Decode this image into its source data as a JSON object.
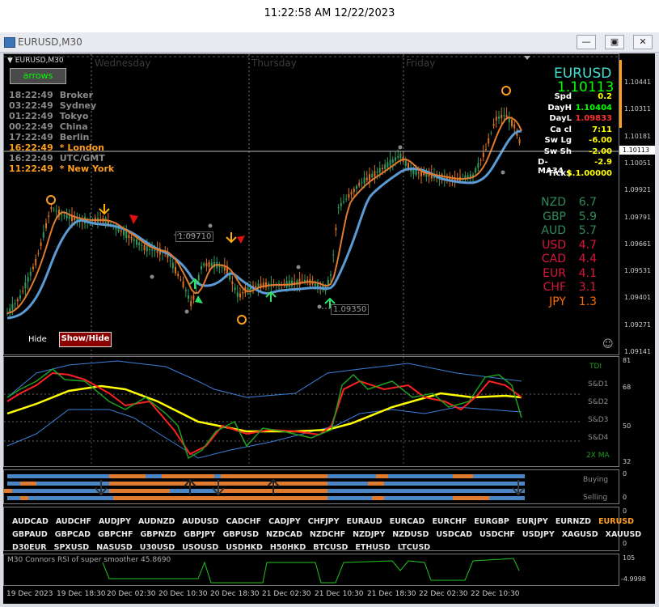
{
  "clock": "11:22:58 AM 12/22/2023",
  "window": {
    "title": "EURUSD,M30"
  },
  "chart": {
    "label": "EURUSD,M30",
    "arrows_button": "arrows",
    "days": [
      "Wednesday",
      "Thursday",
      "Friday"
    ],
    "sessions": [
      {
        "time": "18:22:49",
        "name": "Broker",
        "color": "#8a8a8a"
      },
      {
        "time": "03:22:49",
        "name": "Sydney",
        "color": "#8a8a8a"
      },
      {
        "time": "01:22:49",
        "name": "Tokyo",
        "color": "#8a8a8a"
      },
      {
        "time": "00:22:49",
        "name": "China",
        "color": "#8a8a8a"
      },
      {
        "time": "17:22:49",
        "name": "Berlin",
        "color": "#8a8a8a"
      },
      {
        "time": "16:22:49",
        "name": "* London",
        "color": "#ff9e1b"
      },
      {
        "time": "16:22:49",
        "name": "UTC/GMT",
        "color": "#8a8a8a"
      },
      {
        "time": "11:22:49",
        "name": "* New York",
        "color": "#ff9e1b"
      }
    ],
    "hide_label": "Hide",
    "show_hide_button": "Show/Hide",
    "price_ticks": [
      "1.10441",
      "1.10311",
      "1.10181",
      "1.10051",
      "1.09921",
      "1.09791",
      "1.09661",
      "1.09531",
      "1.09401",
      "1.09271",
      "1.09141"
    ],
    "current_price": "1.10113",
    "annotations": {
      "high_label": "1.09710",
      "low_label": "1.09350"
    }
  },
  "info": {
    "symbol": "EURUSD",
    "price": "1.10113",
    "rows": [
      {
        "label": "Spd",
        "value": "0.2",
        "color": "#ffff00"
      },
      {
        "label": "DayH",
        "value": "1.10404",
        "color": "#00ff00"
      },
      {
        "label": "DayL",
        "value": "1.09833",
        "color": "#ff3030"
      },
      {
        "label": "Ca cl",
        "value": "7:11",
        "color": "#ffff00"
      },
      {
        "label": "Sw Lg",
        "value": "-6.00",
        "color": "#ffff00"
      },
      {
        "label": "Sw Sh",
        "value": "-2.00",
        "color": "#ffff00"
      },
      {
        "label": "D-MA34",
        "value": "-2.9",
        "color": "#ffff00"
      },
      {
        "label": "Tick$",
        "value": "$.1.00000",
        "color": "#ffff00"
      }
    ]
  },
  "strength": [
    {
      "cur": "NZD",
      "val": "6.7",
      "color": "#2e8b57"
    },
    {
      "cur": "GBP",
      "val": "5.9",
      "color": "#2e8b57"
    },
    {
      "cur": "AUD",
      "val": "5.7",
      "color": "#2e8b57"
    },
    {
      "cur": "USD",
      "val": "4.7",
      "color": "#dc143c"
    },
    {
      "cur": "CAD",
      "val": "4.4",
      "color": "#dc143c"
    },
    {
      "cur": "EUR",
      "val": "4.1",
      "color": "#dc143c"
    },
    {
      "cur": "CHF",
      "val": "3.1",
      "color": "#dc143c"
    },
    {
      "cur": "JPY",
      "val": "1.3",
      "color": "#ff6a00"
    }
  ],
  "tdi": {
    "labels": [
      "TDI",
      "S&D1",
      "S&D2",
      "S&D3",
      "S&D4",
      "2X MA"
    ],
    "scale": [
      "81",
      "68",
      "50",
      "32"
    ]
  },
  "trend_panel": {
    "labels": [
      "Buying",
      "Selling"
    ],
    "scale": [
      "0",
      "0"
    ]
  },
  "symbols": {
    "rows": [
      [
        "AUDCAD",
        "AUDCHF",
        "AUDJPY",
        "AUDNZD",
        "AUDUSD",
        "CADCHF",
        "CADJPY",
        "CHFJPY",
        "EURAUD",
        "EURCAD",
        "EURCHF",
        "EURGBP",
        "EURJPY",
        "EURNZD",
        "EURUSD"
      ],
      [
        "GBPAUD",
        "GBPCAD",
        "GBPCHF",
        "GBPNZD",
        "GBPJPY",
        "GBPUSD",
        "NZDCAD",
        "NZDCHF",
        "NZDJPY",
        "NZDUSD",
        "USDCAD",
        "USDCHF",
        "USDJPY",
        "XAGUSD",
        "XAUUSD"
      ],
      [
        "D30EUR",
        "SPXUSD",
        "NASUSD",
        "U30USD",
        "USOUSD",
        "USDHKD",
        "H50HKD",
        "BTCUSD",
        "ETHUSD",
        "LTCUSD"
      ]
    ],
    "active": "EURUSD",
    "scale": [
      "0",
      "0"
    ]
  },
  "rsi": {
    "label": "M30 Connors RSI of super smoother 45.8690",
    "scale": [
      "105",
      "-4.9998"
    ]
  },
  "time_axis": [
    "19 Dec 2023",
    "19 Dec 18:30",
    "20 Dec 02:30",
    "20 Dec 10:30",
    "20 Dec 18:30",
    "21 Dec 02:30",
    "21 Dec 10:30",
    "21 Dec 18:30",
    "22 Dec 02:30",
    "22 Dec 10:30"
  ],
  "colors": {
    "ma_blue": "#5b9bd5",
    "ma_orange": "#e07a2e",
    "candle_green": "#2e9a5e",
    "candle_orange": "#d9731f",
    "tdi_red": "#ff2020",
    "tdi_green": "#1fa01f",
    "tdi_yellow": "#ffff00",
    "band_blue": "#3a7fd9",
    "rsi_green": "#22c322"
  }
}
